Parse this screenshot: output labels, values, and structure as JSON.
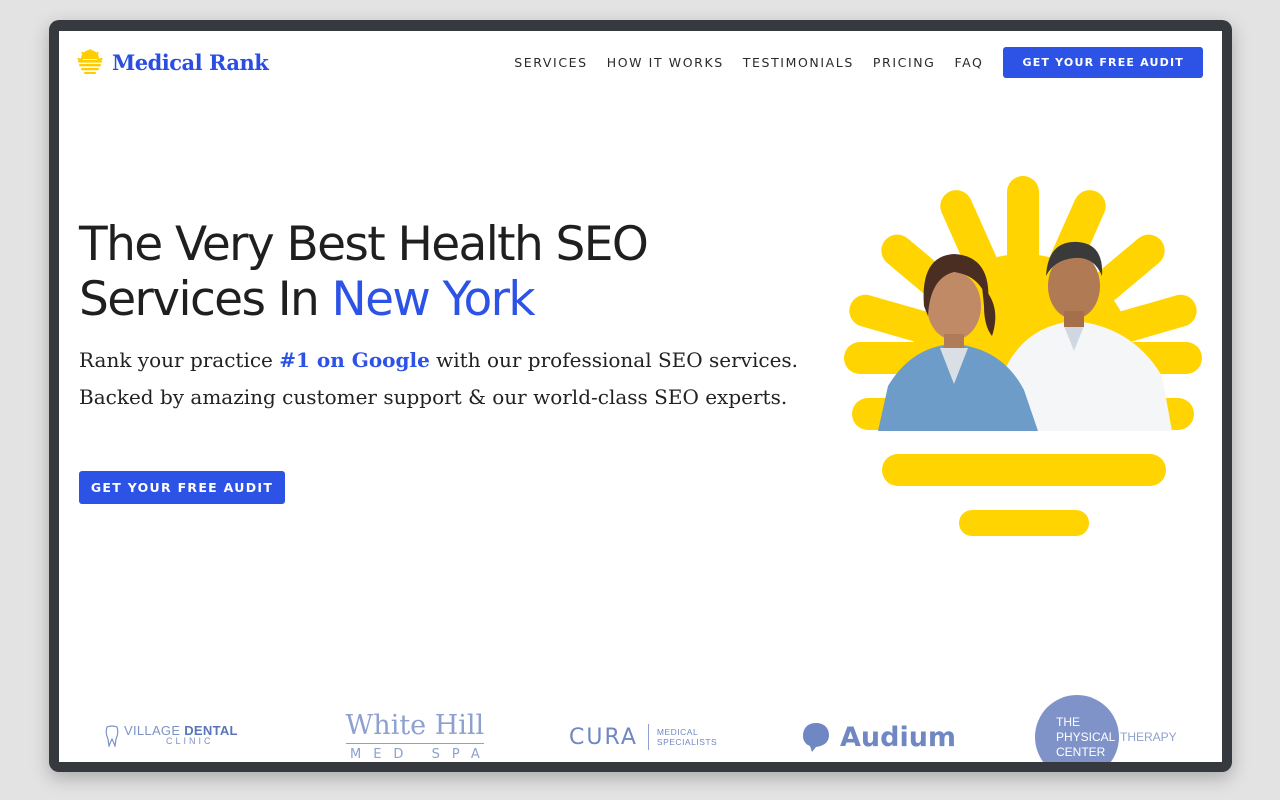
{
  "colors": {
    "accent": "#2d52e6",
    "sun": "#ffd400",
    "logo_strip": "#7f93c9"
  },
  "header": {
    "brand": "Medical Rank",
    "logo_icon": "sun-logo-icon",
    "nav": [
      "SERVICES",
      "HOW IT WORKS",
      "TESTIMONIALS",
      "PRICING",
      "FAQ"
    ],
    "cta": "GET YOUR FREE AUDIT"
  },
  "hero": {
    "title_line1": "The Very Best Health SEO",
    "title_line2_prefix": "Services In ",
    "title_line2_accent": "New York",
    "subtitle_pre": "Rank your practice ",
    "subtitle_highlight": "#1 on Google",
    "subtitle_post": " with our professional SEO services. Backed by amazing customer support & our world-class SEO experts.",
    "cta": "GET YOUR FREE AUDIT",
    "image_alt": "two smiling healthcare professionals in front of a yellow sun graphic"
  },
  "client_logos": {
    "village": {
      "word1": "VILLAGE",
      "word2": "DENTAL",
      "word3": "CLINIC"
    },
    "white_hill": {
      "line1": "White Hill",
      "line2": "MED SPA"
    },
    "cura": {
      "name": "CURA",
      "sub1": "MEDICAL",
      "sub2": "SPECIALISTS"
    },
    "audium": {
      "name": "Audium"
    },
    "pt_center": {
      "line1": "THE",
      "line2": "PHYSICAL",
      "line3": "CENTER",
      "side": "THERAPY"
    }
  }
}
